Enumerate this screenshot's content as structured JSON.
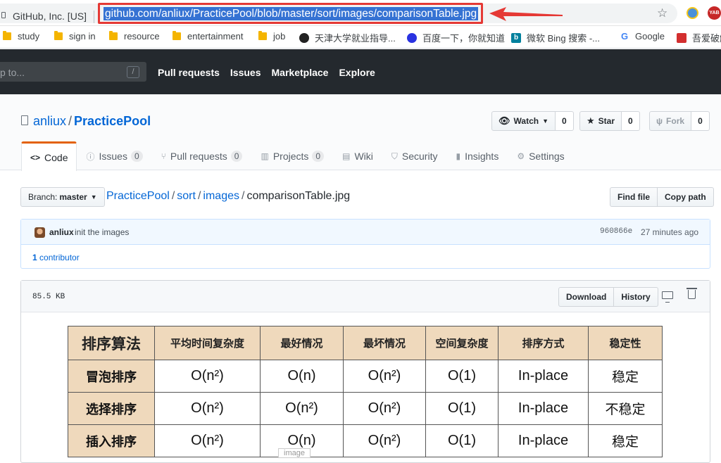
{
  "browser": {
    "site_identity": "GitHub, Inc. [US]",
    "url": "github.com/anliux/PracticePool/blob/master/sort/images/comparisonTable.jpg",
    "bookmarks": [
      {
        "label": "study",
        "icon": "folder-icon"
      },
      {
        "label": "sign in",
        "icon": "folder-icon"
      },
      {
        "label": "resource",
        "icon": "folder-icon"
      },
      {
        "label": "entertainment",
        "icon": "folder-icon"
      },
      {
        "label": "job",
        "icon": "folder-icon"
      },
      {
        "label": "天津大学就业指导...",
        "icon": "tju-icon"
      },
      {
        "label": "百度一下，你就知道",
        "icon": "baidu-icon"
      },
      {
        "label": "微软 Bing 搜索 -...",
        "icon": "bing-icon"
      },
      {
        "label": "Google",
        "icon": "google-icon"
      },
      {
        "label": "吾爱破解",
        "icon": "52pojie-icon"
      }
    ],
    "ext_label": "YAB"
  },
  "github": {
    "search_placeholder": "p to...",
    "search_shortcut": "/",
    "nav": [
      "Pull requests",
      "Issues",
      "Marketplace",
      "Explore"
    ]
  },
  "repo": {
    "owner": "anliux",
    "name": "PracticePool",
    "watch_label": "Watch",
    "watch_count": "0",
    "star_label": "Star",
    "star_count": "0",
    "fork_label": "Fork",
    "fork_count": "0",
    "tabs": [
      {
        "label": "Code",
        "counter": ""
      },
      {
        "label": "Issues",
        "counter": "0"
      },
      {
        "label": "Pull requests",
        "counter": "0"
      },
      {
        "label": "Projects",
        "counter": "0"
      },
      {
        "label": "Wiki",
        "counter": ""
      },
      {
        "label": "Security",
        "counter": ""
      },
      {
        "label": "Insights",
        "counter": ""
      },
      {
        "label": "Settings",
        "counter": ""
      }
    ]
  },
  "file_nav": {
    "branch_prefix": "Branch:",
    "branch_name": "master",
    "crumbs": [
      "PracticePool",
      "sort",
      "images"
    ],
    "file_name": "comparisonTable.jpg",
    "find_file": "Find file",
    "copy_path": "Copy path"
  },
  "commit": {
    "author": "anliux",
    "message": "init the images",
    "sha": "960866e",
    "time": "27 minutes ago",
    "contributors_count": "1",
    "contributors_label": "contributor"
  },
  "file": {
    "size": "85.5 KB",
    "download": "Download",
    "history": "History",
    "image_tooltip": "image"
  },
  "image_table": {
    "headers": [
      "排序算法",
      "平均时间复杂度",
      "最好情况",
      "最坏情况",
      "空间复杂度",
      "排序方式",
      "稳定性"
    ],
    "rows": [
      [
        "冒泡排序",
        "O(n²)",
        "O(n)",
        "O(n²)",
        "O(1)",
        "In-place",
        "稳定"
      ],
      [
        "选择排序",
        "O(n²)",
        "O(n²)",
        "O(n²)",
        "O(1)",
        "In-place",
        "不稳定"
      ],
      [
        "插入排序",
        "O(n²)",
        "O(n)",
        "O(n²)",
        "O(1)",
        "In-place",
        "稳定"
      ]
    ]
  },
  "colors": {
    "header_bg": "#24292e",
    "link": "#0366d6",
    "url_highlight": "#3572d3",
    "annotation_red": "#e53935",
    "table_header_bg": "#efd9bc"
  }
}
